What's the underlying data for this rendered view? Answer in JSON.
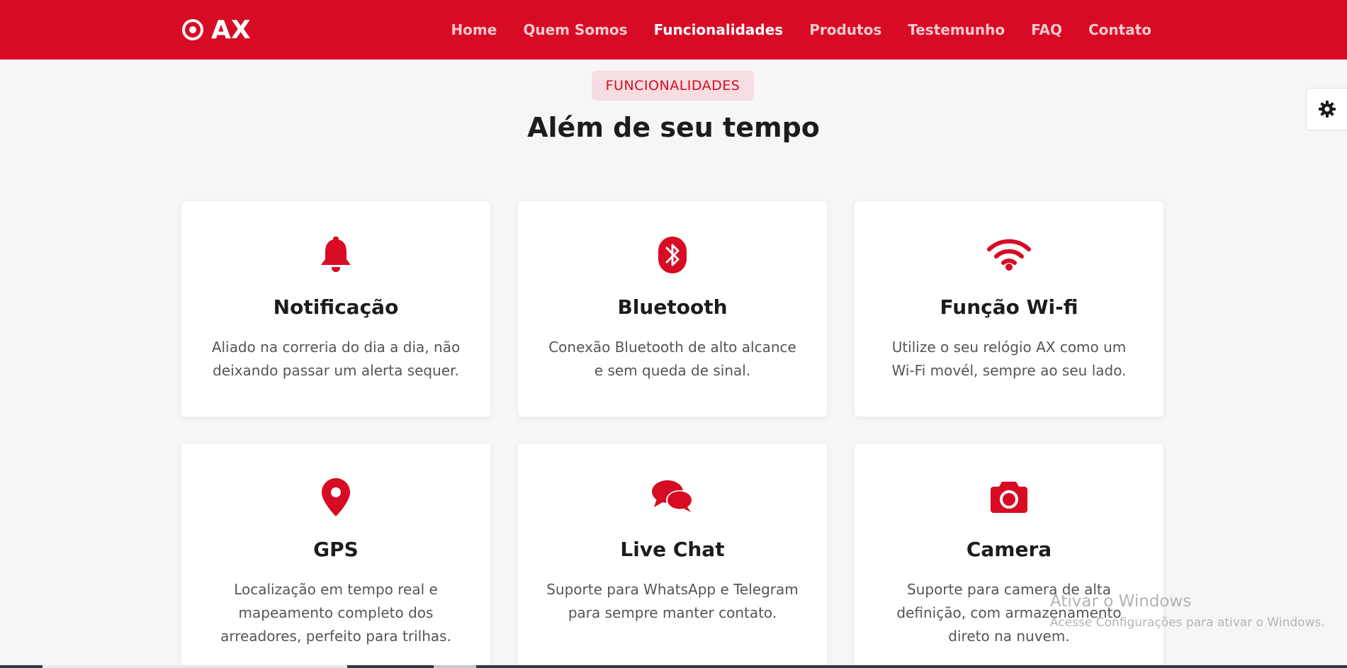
{
  "nav": {
    "logo_text": "AX",
    "links": [
      "Home",
      "Quem Somos",
      "Funcionalidades",
      "Produtos",
      "Testemunho",
      "FAQ",
      "Contato"
    ],
    "active_index": 2
  },
  "section": {
    "badge": "FUNCIONALIDADES",
    "title": "Além de seu tempo"
  },
  "features": [
    {
      "icon": "bell-icon",
      "title": "Notificação",
      "desc_line1": "Aliado na correria do dia a dia, não",
      "desc_line2": "deixando passar um alerta sequer.",
      "desc_line3": ""
    },
    {
      "icon": "bluetooth-icon",
      "title": "Bluetooth",
      "desc_line1": "Conexão Bluetooth de alto alcance",
      "desc_line2": "e sem queda de sinal.",
      "desc_line3": ""
    },
    {
      "icon": "wifi-icon",
      "title": "Função Wi-fi",
      "desc_line1": "Utilize o seu relógio AX como um",
      "desc_line2": "Wi-Fi movél, sempre ao seu lado.",
      "desc_line3": ""
    },
    {
      "icon": "map-pin-icon",
      "title": "GPS",
      "desc_line1": "Localização em tempo real e",
      "desc_line2": "mapeamento completo dos",
      "desc_line3": "arreadores, perfeito para trilhas."
    },
    {
      "icon": "chat-icon",
      "title": "Live Chat",
      "desc_line1": "Suporte para WhatsApp e Telegram",
      "desc_line2": "para sempre manter contato.",
      "desc_line3": ""
    },
    {
      "icon": "camera-icon",
      "title": "Camera",
      "desc_line1": "Suporte para camera de alta",
      "desc_line2": "definição, com armazenamento",
      "desc_line3": "direto na nuvem."
    }
  ],
  "watermark": {
    "title": "Ativar o Windows",
    "subtitle": "Acesse Configurações para ativar o Windows."
  },
  "colors": {
    "brand": "#d80b24",
    "badge_bg": "#f6dde1",
    "page_bg": "#f6f6f7"
  }
}
